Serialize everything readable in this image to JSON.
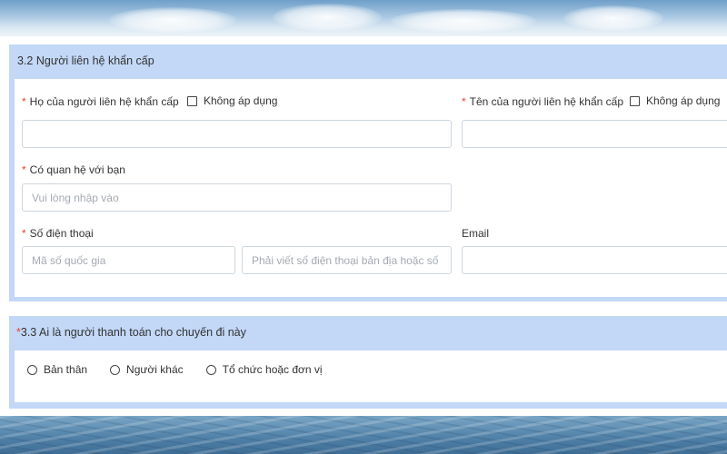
{
  "emergency_contact": {
    "title": "3.2 Người liên hệ khẩn cấp",
    "required_mark": "*",
    "surname": {
      "label": "Họ của người liên hệ khẩn cấp",
      "not_applicable": "Không áp dụng",
      "value": ""
    },
    "given_name": {
      "label": "Tên của người liên hệ khẩn cấp",
      "not_applicable": "Không áp dụng",
      "value": ""
    },
    "relationship": {
      "label": "Có quan hệ với bạn",
      "placeholder": "Vui lòng nhập vào"
    },
    "phone": {
      "label": "Số điện thoại",
      "country_code_placeholder": "Mã số quốc gia",
      "number_placeholder": "Phải viết số điện thoại bản địa hoặc số điện thoại di động"
    },
    "email": {
      "label": "Email",
      "value": ""
    }
  },
  "payer": {
    "required_mark": "*",
    "title": "3.3 Ai là người thanh toán cho chuyến đi này",
    "options": [
      "Bản thân",
      "Người khác",
      "Tổ chức hoặc đơn vị"
    ]
  },
  "colors": {
    "section_header_bg": "#c3d8f7",
    "required": "#e3452f",
    "input_border": "#cfd6de",
    "placeholder": "#a5aab2"
  }
}
